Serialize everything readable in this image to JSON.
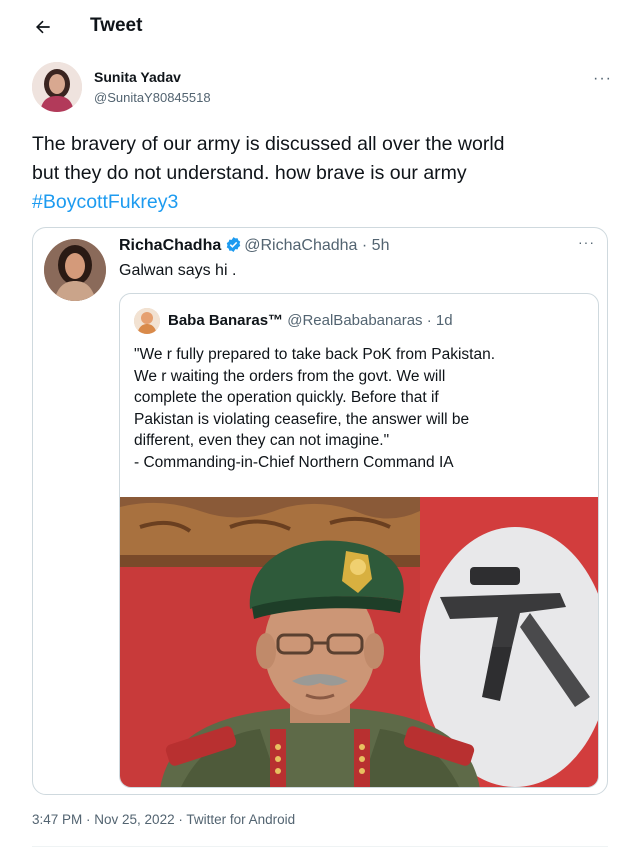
{
  "header": {
    "title": "Tweet",
    "back_icon": "arrow-left-icon"
  },
  "tweet": {
    "author_name": "Sunita Yadav",
    "author_handle": "@SunitaY80845518",
    "more_icon": "ellipsis-icon",
    "more_symbol": "···",
    "text_line1": "The bravery of our army is discussed all over the world",
    "text_line2": "but they do not understand.  how brave is our army",
    "hashtag": "#BoycottFukrey3",
    "timestamp": "3:47 PM · Nov 25, 2022 · Twitter for Android"
  },
  "quote": {
    "author_name": "RichaChadha",
    "verified_icon": "verified-badge-icon",
    "author_handle": "@RichaChadha",
    "time_sep": " · ",
    "time": "5h",
    "more_symbol": "···",
    "text": "Galwan says hi ."
  },
  "inner_quote": {
    "author_name": "Baba Banaras™",
    "author_handle": "@RealBababanaras",
    "time_sep": " · ",
    "time": "1d",
    "lines": [
      "\"We r fully prepared to take back PoK from Pakistan.",
      "We r waiting the orders from the govt. We will",
      "complete the operation quickly. Before that if",
      "Pakistan is violating ceasefire, the answer will be",
      "different, even they can not imagine.\"",
      "- Commanding-in-Chief Northern Command IA"
    ]
  },
  "colors": {
    "text": "#0f1419",
    "muted": "#536471",
    "link": "#1d9bf0",
    "border": "#cfd9de"
  }
}
